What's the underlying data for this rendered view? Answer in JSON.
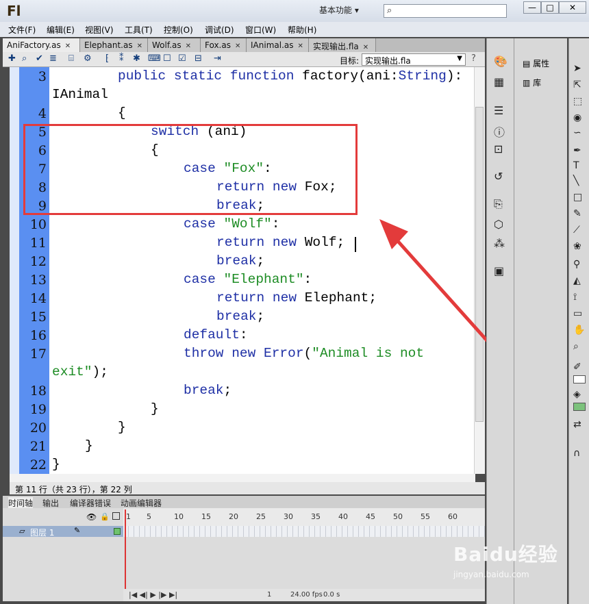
{
  "app": {
    "logo": "Fl",
    "workspace": "基本功能",
    "workspace_arrow": "▾",
    "search_icon": "⌕",
    "min": "—",
    "max": "□",
    "close": "✕"
  },
  "menu": [
    "文件(F)",
    "编辑(E)",
    "视图(V)",
    "工具(T)",
    "控制(O)",
    "调试(D)",
    "窗口(W)",
    "帮助(H)"
  ],
  "tabs": [
    {
      "label": "AniFactory.as"
    },
    {
      "label": "Elephant.as"
    },
    {
      "label": "Wolf.as"
    },
    {
      "label": "Fox.as"
    },
    {
      "label": "IAnimal.as"
    },
    {
      "label": "实现输出.fla"
    }
  ],
  "toolbar": {
    "target_label": "目标:",
    "target_value": "实现输出.fla",
    "help": "?"
  },
  "code": {
    "line_numbers": [
      "3",
      "4",
      "5",
      "6",
      "7",
      "8",
      "9",
      "10",
      "11",
      "12",
      "13",
      "14",
      "15",
      "16",
      "17",
      "18",
      "19",
      "20",
      "21",
      "22"
    ],
    "l3a": "public static function ",
    "l3b": "factory(ani:",
    "l3c": "String",
    "l3d": "):",
    "l3e": "IAnimal",
    "l4": "{",
    "l5a": "switch ",
    "l5b": "(ani)",
    "l6": "{",
    "l7a": "case ",
    "l7b": "\"Fox\"",
    "l7c": ":",
    "l8a": "return new ",
    "l8b": "Fox;",
    "l9a": "break",
    ";": ";",
    "l10a": "case ",
    "l10b": "\"Wolf\"",
    "l10c": ":",
    "l11a": "return new ",
    "l11b": "Wolf;",
    "l12a": "break",
    "l12b": ";",
    "l13a": "case ",
    "l13b": "\"Elephant\"",
    "l13c": ":",
    "l14a": "return new ",
    "l14b": "Elephant;",
    "l15a": "break",
    "l15b": ";",
    "l16a": "default",
    ":": ":",
    "l17a": "throw new ",
    "l17b": "Error",
    "l17c": "(",
    "l17d": "\"Animal is not",
    "l17e": "exit\"",
    "l17f": ");",
    "l18a": "break",
    "l18b": ";",
    "l19": "}",
    "l20": "}",
    "l21": "}",
    "l22": "}"
  },
  "status": "第 11 行（共 23 行），第 22 列",
  "timeline": {
    "tabs": [
      "时间轴",
      "输出",
      "编译器错误",
      "动画编辑器"
    ],
    "ticks": [
      "1",
      "5",
      "10",
      "15",
      "20",
      "25",
      "30",
      "35",
      "40",
      "45",
      "50",
      "55",
      "60"
    ],
    "layer": "图层 1",
    "fps": "24.00 fps",
    "time": "0.0 s",
    "frame": "1"
  },
  "panels": {
    "properties": "属性",
    "library": "库"
  },
  "watermark": {
    "brand": "Baidu经验",
    "url": "jingyan.baidu.com"
  }
}
